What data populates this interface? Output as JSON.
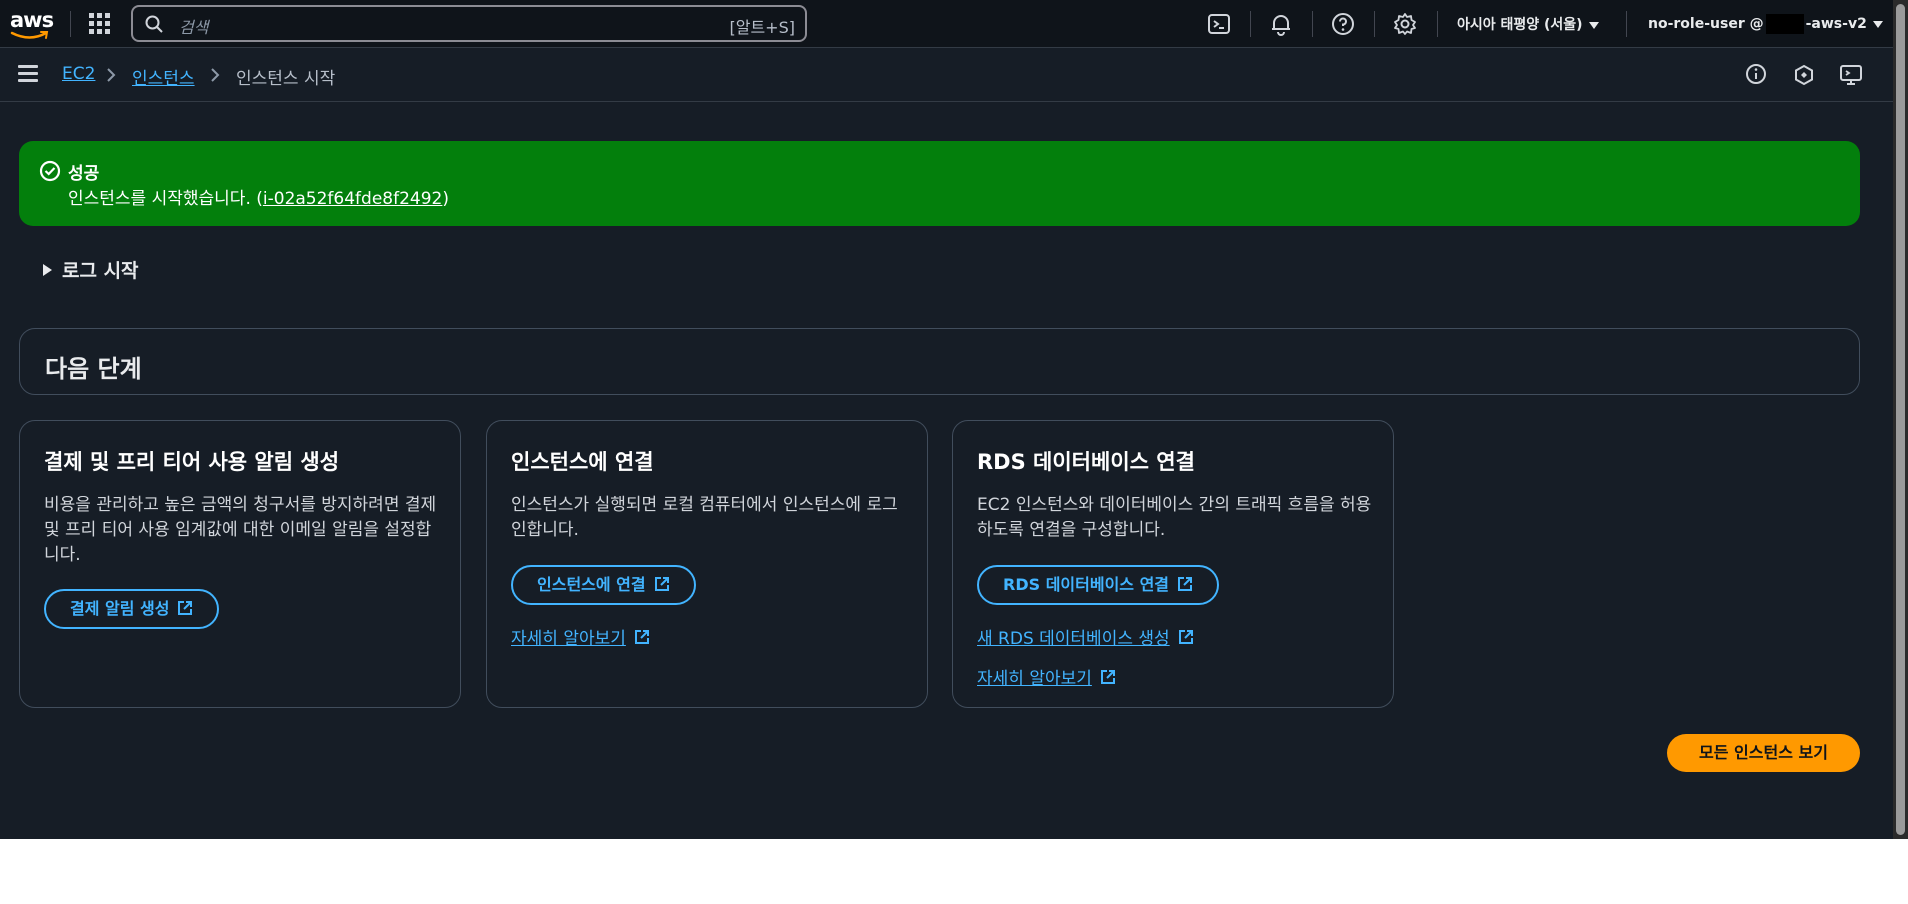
{
  "topnav": {
    "logo_text": "aws",
    "search_placeholder": "검색",
    "search_shortcut": "[알트+S]",
    "icons": [
      "cloudshell-icon",
      "bell-icon",
      "help-icon",
      "gear-icon"
    ],
    "region": "아시아 태평양 (서울)",
    "user_prefix": "no-role-user @",
    "user_suffix": "-aws-v2"
  },
  "breadcrumb": [
    "EC2",
    "인스턴스",
    "인스턴스 시작"
  ],
  "subnav_icons": [
    "info-icon",
    "hexagon-icon",
    "screen-icon"
  ],
  "flash": {
    "title": "성공",
    "message": "인스턴스를 시작했습니다. (",
    "instance_id": "i-02a52f64fde8f2492",
    "close": ")",
    "color": "#037f0c"
  },
  "expander": {
    "label": "로그 시작"
  },
  "next_steps": {
    "title": "다음 단계"
  },
  "cards": [
    {
      "title": "결제 및 프리 티어 사용 알림 생성",
      "desc": "비용을 관리하고 높은 금액의 청구서를 방지하려면 결제 및 프리 티어 사용 임계값에 대한 이메일 알림을 설정합니다.",
      "button": "결제 알림 생성"
    },
    {
      "title": "인스턴스에 연결",
      "desc": "인스턴스가 실행되면 로컬 컴퓨터에서 인스턴스에 로그인합니다.",
      "button": "인스턴스에 연결",
      "link1": "자세히 알아보기"
    },
    {
      "title": "RDS 데이터베이스 연결",
      "desc": "EC2 인스턴스와 데이터베이스 간의 트래픽 흐름을 허용하도록 연결을 구성합니다.",
      "button": "RDS 데이터베이스 연결",
      "link1": "새 RDS 데이터베이스 생성",
      "link2": "자세히 알아보기"
    }
  ],
  "primary_button": "모든 인스턴스 보기",
  "colors": {
    "accent": "#42b4ff",
    "primary": "#ff9900",
    "background": "#161d26"
  }
}
